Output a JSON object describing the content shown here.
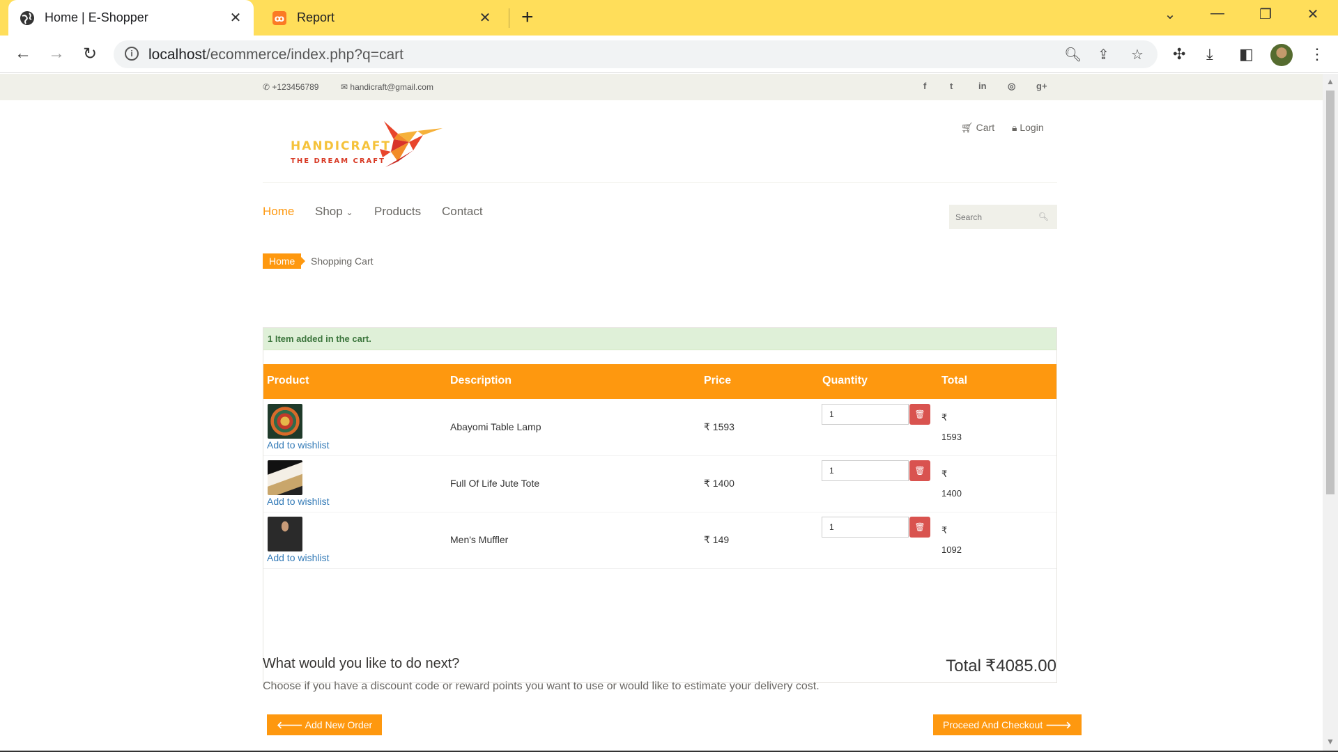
{
  "browser": {
    "tabs": [
      {
        "title": "Home | E-Shopper",
        "icon": "globe-icon",
        "close": "✕"
      },
      {
        "title": "Report",
        "icon": "xampp-icon",
        "close": "✕"
      }
    ],
    "new_tab": "+",
    "url_host": "localhost",
    "url_path": "/ecommerce/index.php?q=cart",
    "window_controls": {
      "dropdown": "⌄",
      "minimize": "—",
      "restore": "❐",
      "close": "✕"
    }
  },
  "topbar": {
    "phone": "+123456789",
    "email": "handicraft@gmail.com",
    "social": [
      "f",
      "t",
      "in",
      "◎",
      "g+"
    ]
  },
  "logo": {
    "line1": "HANDICRAFT",
    "line2": "THE DREAM CRAFT"
  },
  "header_links": {
    "cart": "Cart",
    "login": "Login"
  },
  "nav": {
    "home": "Home",
    "shop": "Shop",
    "products": "Products",
    "contact": "Contact",
    "search_placeholder": "Search"
  },
  "breadcrumb": {
    "home": "Home",
    "current": "Shopping Cart"
  },
  "alert": "1 Item added in the cart.",
  "table": {
    "headers": {
      "product": "Product",
      "description": "Description",
      "price": "Price",
      "quantity": "Quantity",
      "total": "Total"
    },
    "wishlist_label": "Add to wishlist",
    "currency": "₹",
    "rows": [
      {
        "description": "Abayomi Table Lamp",
        "price": "₹ 1593",
        "qty": "1",
        "total": "1593"
      },
      {
        "description": "Full Of Life Jute Tote",
        "price": "₹ 1400",
        "qty": "1",
        "total": "1400"
      },
      {
        "description": "Men's Muffler",
        "price": "₹ 149",
        "qty": "1",
        "total": "1092"
      }
    ],
    "grand_total_label": "Total",
    "grand_total_value": "₹4085.00"
  },
  "next": {
    "heading": "What would you like to do next?",
    "description": "Choose if you have a discount code or reward points you want to use or would like to estimate your delivery cost.",
    "add_order": "Add New Order",
    "checkout": "Proceed And Checkout"
  },
  "colors": {
    "accent": "#fe980f",
    "tabbar": "#ffde5a",
    "alert_bg": "#dff0d8",
    "delete": "#d9534f",
    "link": "#337ab7"
  }
}
